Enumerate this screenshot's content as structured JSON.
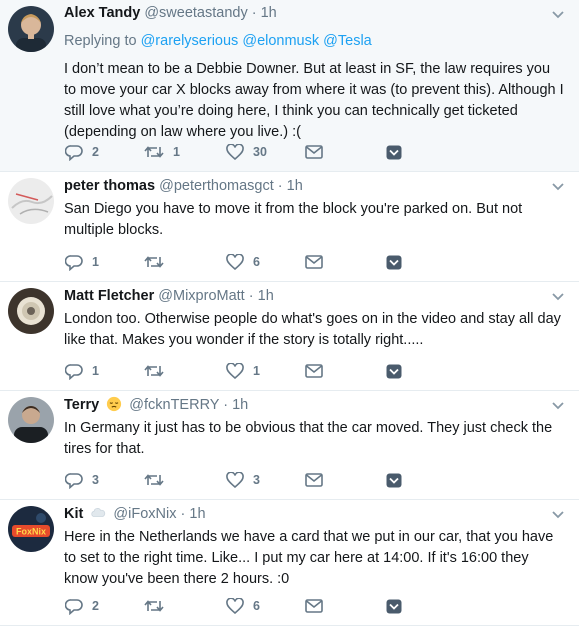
{
  "tweets": [
    {
      "name": "Alex Tandy",
      "handle": "@sweetastandy",
      "sep": "·",
      "time": "1h",
      "reply_prefix": "Replying to",
      "reply_to": [
        "@rarelyserious",
        "@elonmusk",
        "@Tesla"
      ],
      "text": "I don’t mean to be a Debbie Downer. But at least in SF, the law requires you to move your car X blocks away from where it was (to prevent this). Although I still love what you’re doing here, I think you can technically get ticketed (depending on law where you live.) :(",
      "replies": "2",
      "retweets": "1",
      "likes": "30"
    },
    {
      "name": "peter thomas",
      "handle": "@peterthomasgct",
      "sep": "·",
      "time": "1h",
      "text": "San Diego you have to move it from the block you're parked on.  But not multiple blocks.",
      "replies": "1",
      "retweets": "",
      "likes": "6"
    },
    {
      "name": "Matt Fletcher",
      "handle": "@MixproMatt",
      "sep": "·",
      "time": "1h",
      "text": "London too. Otherwise people do what's goes on in the video and stay all day like that. Makes you wonder if the story is totally right.....",
      "replies": "1",
      "retweets": "",
      "likes": "1"
    },
    {
      "name": "Terry",
      "handle": "@fcknTERRY",
      "sep": "·",
      "time": "1h",
      "emoji": "pensive-face-emoji",
      "text": "In Germany it just has to be obvious that the car moved. They just check the tires for that.",
      "replies": "3",
      "retweets": "",
      "likes": "3"
    },
    {
      "name": "Kit",
      "handle": "@iFoxNix",
      "sep": "·",
      "time": "1h",
      "emoji": "cloud-emoji",
      "avatar_text": "FoxNix",
      "text": "Here in the Netherlands we have a card that we put in our car, that you have to set to the right time. Like... I put my car here at 14:00. If it's 16:00 they know you've been there 2 hours. :0",
      "replies": "2",
      "retweets": "",
      "likes": "6"
    }
  ],
  "colors": {
    "accent": "#1da1f2",
    "muted": "#657786",
    "highlight_bg": "#f5f8fa",
    "border": "#e6ecf0"
  },
  "icons": [
    "reply-icon",
    "retweet-icon",
    "like-icon",
    "mail-icon",
    "direct-message-icon",
    "chevron-down-icon"
  ]
}
